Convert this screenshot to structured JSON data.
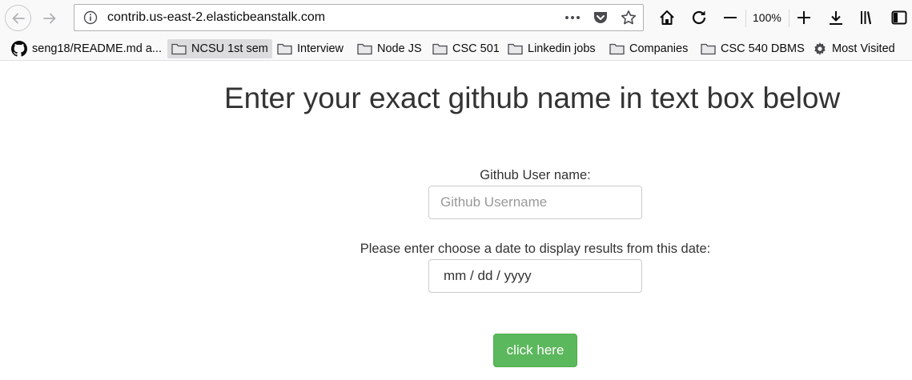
{
  "browser": {
    "url": "contrib.us-east-2.elasticbeanstalk.com",
    "zoom": "100%",
    "bookmarks": [
      {
        "label": "seng18/README.md a...",
        "icon": "github-icon"
      },
      {
        "label": "NCSU 1st sem",
        "icon": "folder-icon"
      },
      {
        "label": "Interview",
        "icon": "folder-icon"
      },
      {
        "label": "Node JS",
        "icon": "folder-icon"
      },
      {
        "label": "CSC 501",
        "icon": "folder-icon"
      },
      {
        "label": "Linkedin jobs",
        "icon": "folder-icon"
      },
      {
        "label": "Companies",
        "icon": "folder-icon"
      },
      {
        "label": "CSC 540 DBMS",
        "icon": "folder-icon"
      },
      {
        "label": "Most Visited",
        "icon": "gear-icon"
      }
    ]
  },
  "page": {
    "title": "Enter your exact github name in text box below",
    "username_label": "Github User name:",
    "username_placeholder": "Github Username",
    "date_label": "Please enter choose a date to display results from this date:",
    "date_value": "mm / dd / yyyy",
    "submit_label": "click here"
  },
  "colors": {
    "button": "#5cb85c",
    "title_text": "#333333"
  }
}
